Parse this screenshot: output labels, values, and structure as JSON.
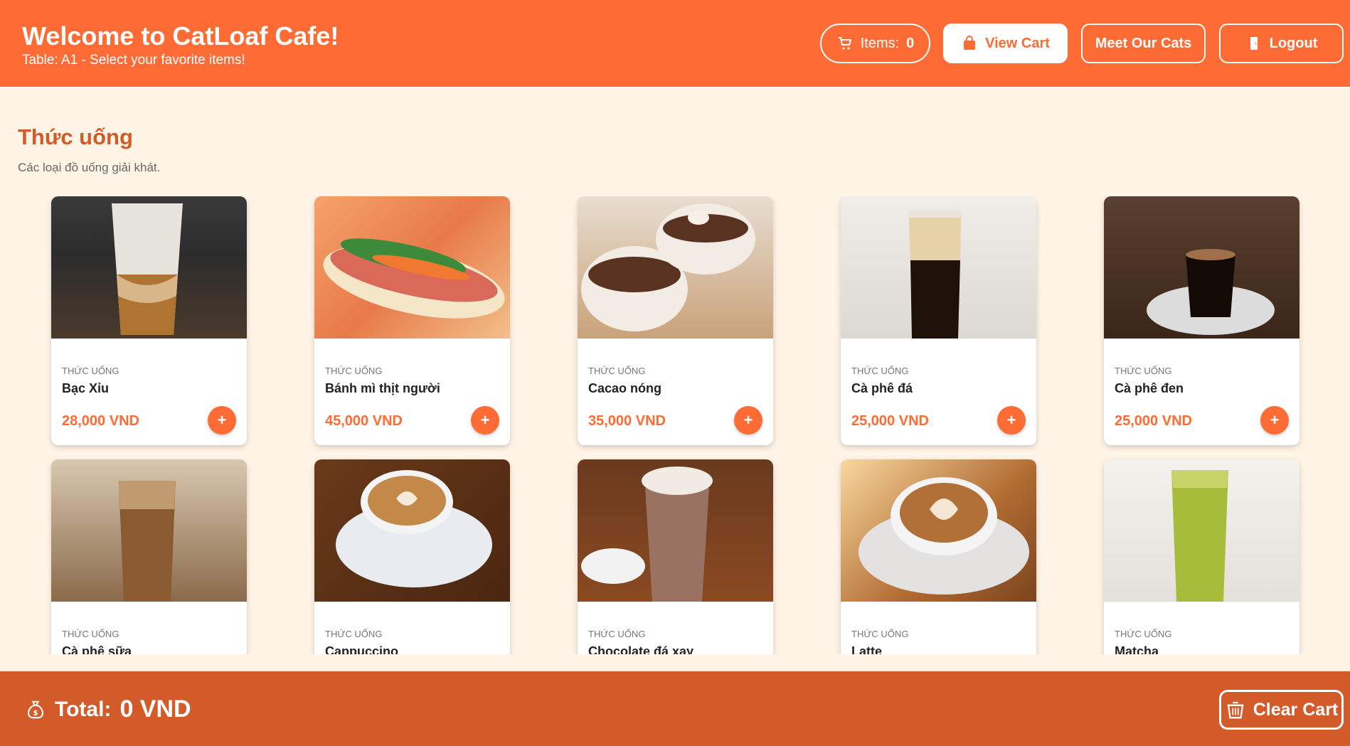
{
  "header": {
    "title": "Welcome to CatLoaf Cafe!",
    "subtitle": "Table: A1 - Select your favorite items!",
    "items_label": "Items:",
    "items_count": "0",
    "view_cart": "View Cart",
    "meet_cats": "Meet Our Cats",
    "logout": "Logout"
  },
  "section": {
    "title": "Thức uống",
    "description": "Các loại đồ uống giải khát."
  },
  "products": [
    {
      "category": "THỨC UỐNG",
      "name": "Bạc Xỉu",
      "price": "28,000 VND",
      "add": "+"
    },
    {
      "category": "THỨC UỐNG",
      "name": "Bánh mì thịt người",
      "price": "45,000 VND",
      "add": "+"
    },
    {
      "category": "THỨC UỐNG",
      "name": "Cacao nóng",
      "price": "35,000 VND",
      "add": "+"
    },
    {
      "category": "THỨC UỐNG",
      "name": "Cà phê đá",
      "price": "25,000 VND",
      "add": "+"
    },
    {
      "category": "THỨC UỐNG",
      "name": "Cà phê đen",
      "price": "25,000 VND",
      "add": "+"
    },
    {
      "category": "THỨC UỐNG",
      "name": "Cà phê sữa",
      "price": "",
      "add": "+"
    },
    {
      "category": "THỨC UỐNG",
      "name": "Cappuccino",
      "price": "",
      "add": "+"
    },
    {
      "category": "THỨC UỐNG",
      "name": "Chocolate đá xay",
      "price": "",
      "add": "+"
    },
    {
      "category": "THỨC UỐNG",
      "name": "Latte",
      "price": "",
      "add": "+"
    },
    {
      "category": "THỨC UỐNG",
      "name": "Matcha",
      "price": "",
      "add": "+"
    }
  ],
  "footer": {
    "total_label": "Total:",
    "total_value": "0 VND",
    "clear_cart": "Clear Cart"
  },
  "colors": {
    "accent": "#ff6b35",
    "footer": "#d35b2a",
    "background": "#fff4e6"
  }
}
